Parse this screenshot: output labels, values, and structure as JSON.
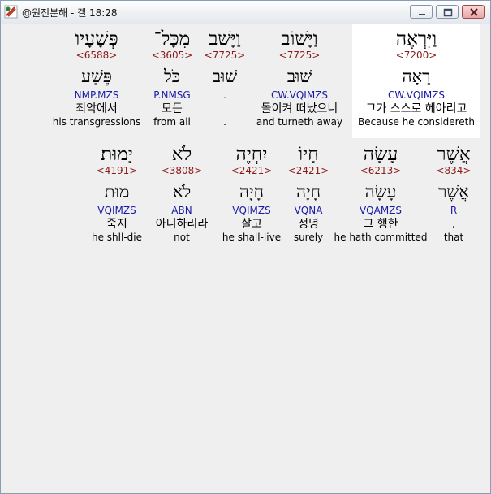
{
  "window": {
    "title": "@원전분해 - 겔 18:28"
  },
  "rows": [
    {
      "words": [
        {
          "hebrew": "וַיִּרְאֶה",
          "strong": "<7200>",
          "root": "רָאָה",
          "morph": "CW.VQIMZS",
          "korean": "그가 스스로 헤아리고",
          "english": "Because he considereth",
          "highlight": true
        },
        {
          "hebrew": "וַיָּשׁוֹב",
          "strong": "<7725>",
          "root": "שׁוּב",
          "morph": "CW.VQIMZS",
          "korean": "돌이켜 떠났으니",
          "english": "and turneth away",
          "highlight": false
        },
        {
          "hebrew": "וַיָּשׁב",
          "strong": "<7725>",
          "root": "שׁוּב",
          "morph": ".",
          "korean": "",
          "english": ".",
          "highlight": false
        },
        {
          "hebrew": "מִכָּל־",
          "strong": "<3605>",
          "root": "כֹּל",
          "morph": "P.NMSG",
          "korean": "모든",
          "english": "from all",
          "highlight": false
        },
        {
          "hebrew": "פְּשָׁעָיו",
          "strong": "<6588>",
          "root": "פֶּשַׁע",
          "morph": "NMP.MZS",
          "korean": "죄악에서",
          "english": "his transgressions",
          "highlight": false
        }
      ]
    },
    {
      "words": [
        {
          "hebrew": "אֲשֶׁר",
          "strong": "<834>",
          "root": "אֲשֶׁר",
          "morph": "R",
          "korean": ".",
          "english": "that",
          "highlight": false
        },
        {
          "hebrew": "עָשָׂה",
          "strong": "<6213>",
          "root": "עָשָׂה",
          "morph": "VQAMZS",
          "korean": "그 행한",
          "english": "he hath committed",
          "highlight": false
        },
        {
          "hebrew": "חָיוֹ",
          "strong": "<2421>",
          "root": "חָיָה",
          "morph": "VQNA",
          "korean": "정녕",
          "english": "surely",
          "highlight": false
        },
        {
          "hebrew": "יִחְיֶה",
          "strong": "<2421>",
          "root": "חָיָה",
          "morph": "VQIMZS",
          "korean": "살고",
          "english": "he shall-live",
          "highlight": false
        },
        {
          "hebrew": "לֹא",
          "strong": "<3808>",
          "root": "לֹא",
          "morph": "ABN",
          "korean": "아니하리라",
          "english": "not",
          "highlight": false
        },
        {
          "hebrew": "יָמוּת׃",
          "strong": "<4191>",
          "root": "מוּת",
          "morph": "VQIMZS",
          "korean": "죽지",
          "english": "he shll-die",
          "highlight": false
        }
      ]
    }
  ]
}
